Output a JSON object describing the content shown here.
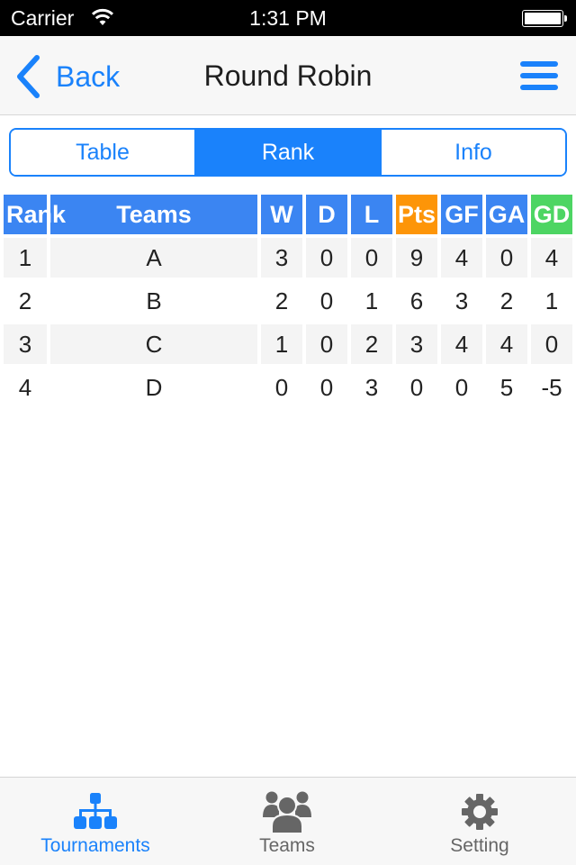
{
  "status_bar": {
    "carrier": "Carrier",
    "time": "1:31 PM",
    "wifi_icon": "wifi-icon",
    "battery_icon": "battery-full-icon"
  },
  "nav": {
    "back_label": "Back",
    "title": "Round Robin",
    "back_icon": "chevron-left-icon",
    "menu_icon": "hamburger-menu-icon"
  },
  "segments": [
    {
      "label": "Table",
      "active": false
    },
    {
      "label": "Rank",
      "active": true
    },
    {
      "label": "Info",
      "active": false
    }
  ],
  "table": {
    "headers": {
      "rank": "Rank",
      "team": "Teams",
      "w": "W",
      "d": "D",
      "l": "L",
      "pts": "Pts",
      "gf": "GF",
      "ga": "GA",
      "gd": "GD"
    },
    "header_colors": {
      "default": "#3b85f2",
      "pts": "#fd9508",
      "gd": "#4dd563"
    },
    "rows": [
      {
        "rank": "1",
        "team": "A",
        "w": "3",
        "d": "0",
        "l": "0",
        "pts": "9",
        "gf": "4",
        "ga": "0",
        "gd": "4"
      },
      {
        "rank": "2",
        "team": "B",
        "w": "2",
        "d": "0",
        "l": "1",
        "pts": "6",
        "gf": "3",
        "ga": "2",
        "gd": "1"
      },
      {
        "rank": "3",
        "team": "C",
        "w": "1",
        "d": "0",
        "l": "2",
        "pts": "3",
        "gf": "4",
        "ga": "4",
        "gd": "0"
      },
      {
        "rank": "4",
        "team": "D",
        "w": "0",
        "d": "0",
        "l": "3",
        "pts": "0",
        "gf": "0",
        "ga": "5",
        "gd": "-5"
      }
    ]
  },
  "tab_bar": {
    "items": [
      {
        "label": "Tournaments",
        "icon": "bracket-hierarchy-icon",
        "active": true
      },
      {
        "label": "Teams",
        "icon": "people-group-icon",
        "active": false
      },
      {
        "label": "Setting",
        "icon": "gear-icon",
        "active": false
      }
    ]
  },
  "colors": {
    "accent": "#1a82fb",
    "inactive_tab": "#666666"
  }
}
